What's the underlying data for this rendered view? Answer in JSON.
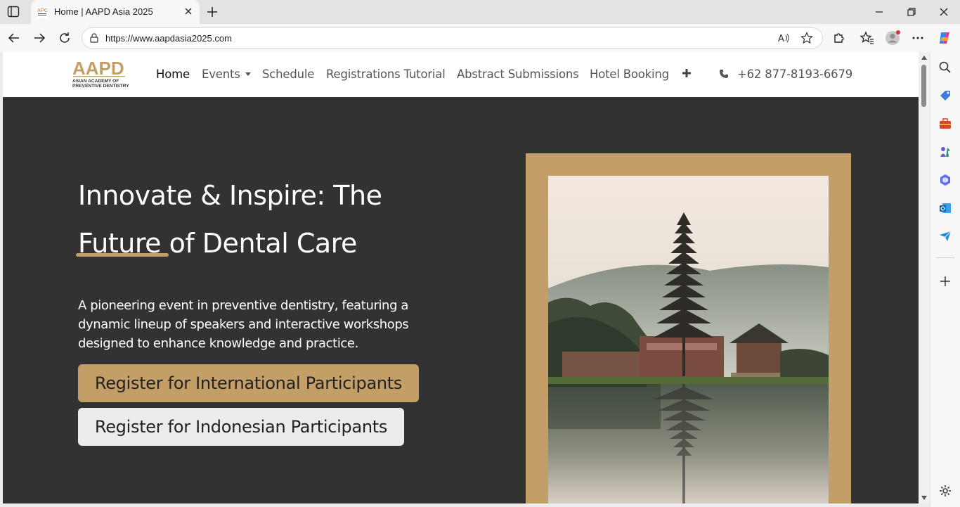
{
  "browser": {
    "tab_title": "Home | AAPD Asia 2025",
    "url": "https://www.aapdasia2025.com"
  },
  "site": {
    "logo": {
      "name": "AAPD",
      "line1": "ASIAN ACADEMY OF",
      "line2": "PREVENTIVE DENTISTRY"
    },
    "nav": {
      "home": "Home",
      "events": "Events",
      "schedule": "Schedule",
      "registrations": "Registrations Tutorial",
      "abstracts": "Abstract Submissions",
      "hotel": "Hotel Booking",
      "phone": "+62 877-8193-6679"
    }
  },
  "hero": {
    "headline_line1": "Innovate & Inspire: The",
    "headline_line2": "Future of Dental Care",
    "description": "A pioneering event in preventive dentistry, featuring a dynamic lineup of speakers and interactive workshops designed to enhance knowledge and practice.",
    "btn_international": "Register for International Participants",
    "btn_indonesian": "Register for Indonesian Participants"
  },
  "colors": {
    "accent": "#c49e67",
    "hero_bg": "#323232",
    "light_button": "#ececec"
  }
}
